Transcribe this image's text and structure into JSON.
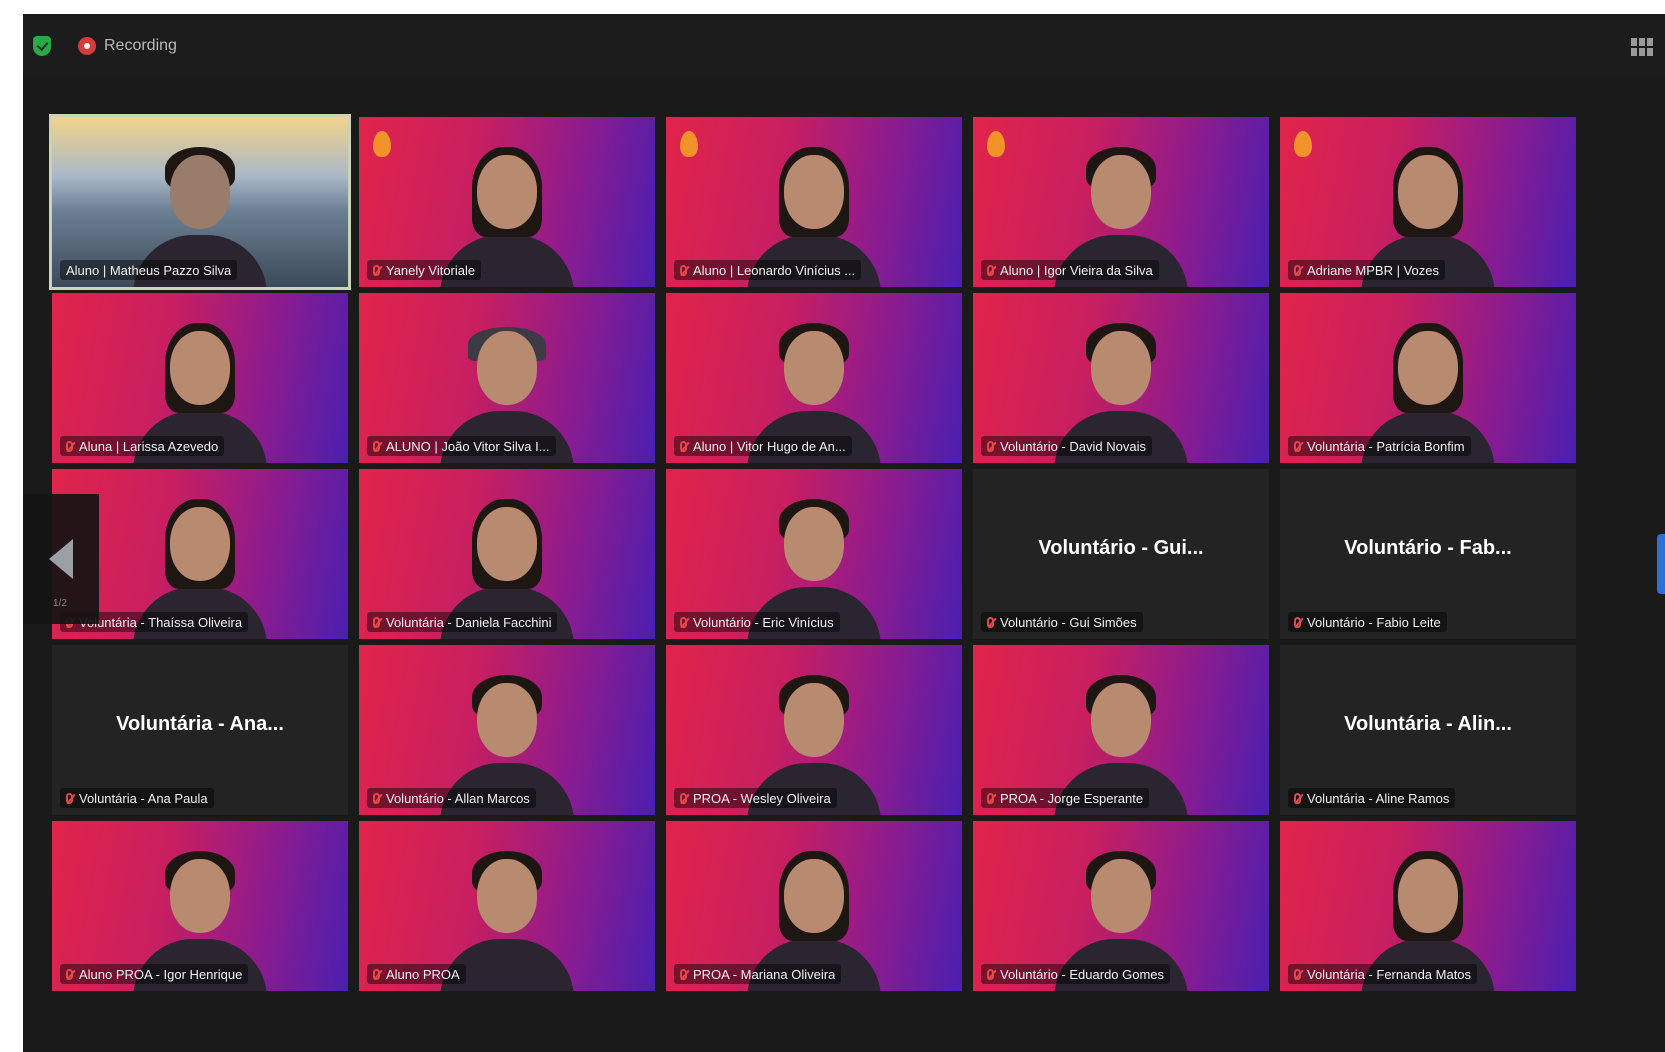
{
  "toolbar": {
    "recording_label": "Recording"
  },
  "navigation": {
    "page_indicator": "1/2"
  },
  "participants": [
    {
      "name": "Aluno | Matheus Pazzo Silva",
      "video": "camera"
    },
    {
      "name": "Yanely Vitoriale",
      "video": "background"
    },
    {
      "name": "Aluno | Leonardo Vinícius ...",
      "video": "background"
    },
    {
      "name": "Aluno | Igor Vieira da Silva",
      "video": "background"
    },
    {
      "name": "Adriane MPBR | Vozes",
      "video": "background"
    },
    {
      "name": "Aluna | Larissa Azevedo",
      "video": "background"
    },
    {
      "name": "ALUNO | João Vitor Silva I...",
      "video": "background"
    },
    {
      "name": "Aluno | Vitor Hugo de An...",
      "video": "background"
    },
    {
      "name": "Voluntário - David Novais",
      "video": "background"
    },
    {
      "name": "Voluntária - Patrícia Bonfim",
      "video": "background"
    },
    {
      "name": "Voluntária - Thaíssa Oliveira",
      "video": "background"
    },
    {
      "name": "Voluntária - Daniela Facchini",
      "video": "background"
    },
    {
      "name": "Voluntário - Eric Vinícius",
      "video": "background"
    },
    {
      "name": "Voluntário - Gui Simões",
      "video": "off",
      "display_name": "Voluntário - Gui..."
    },
    {
      "name": "Voluntário - Fabio Leite",
      "video": "off",
      "display_name": "Voluntário - Fab..."
    },
    {
      "name": "Voluntária - Ana Paula",
      "video": "off",
      "display_name": "Voluntária - Ana..."
    },
    {
      "name": "Voluntário - Allan Marcos",
      "video": "background"
    },
    {
      "name": "PROA - Wesley Oliveira",
      "video": "background"
    },
    {
      "name": "PROA - Jorge Esperante",
      "video": "background"
    },
    {
      "name": "Voluntária - Aline Ramos",
      "video": "off",
      "display_name": "Voluntária - Alin..."
    },
    {
      "name": "Aluno PROA - Igor Henrique",
      "video": "background"
    },
    {
      "name": "Aluno PROA",
      "video": "background"
    },
    {
      "name": "PROA - Mariana Oliveira",
      "video": "background"
    },
    {
      "name": "Voluntário - Eduardo Gomes",
      "video": "background"
    },
    {
      "name": "Voluntária - Fernanda Matos",
      "video": "background"
    }
  ],
  "colors": {
    "tile_gradient_start": "#e0244a",
    "tile_gradient_end": "#4a1fb0",
    "window_bg": "#1a1a1a",
    "muted_mic": "#e04a4a",
    "security_shield": "#2aa84a"
  },
  "icons": {
    "security": "shield-check-icon",
    "recording": "record-icon",
    "view": "grid-view-icon",
    "previous_page": "chevron-left-icon",
    "muted": "mic-muted-icon"
  }
}
